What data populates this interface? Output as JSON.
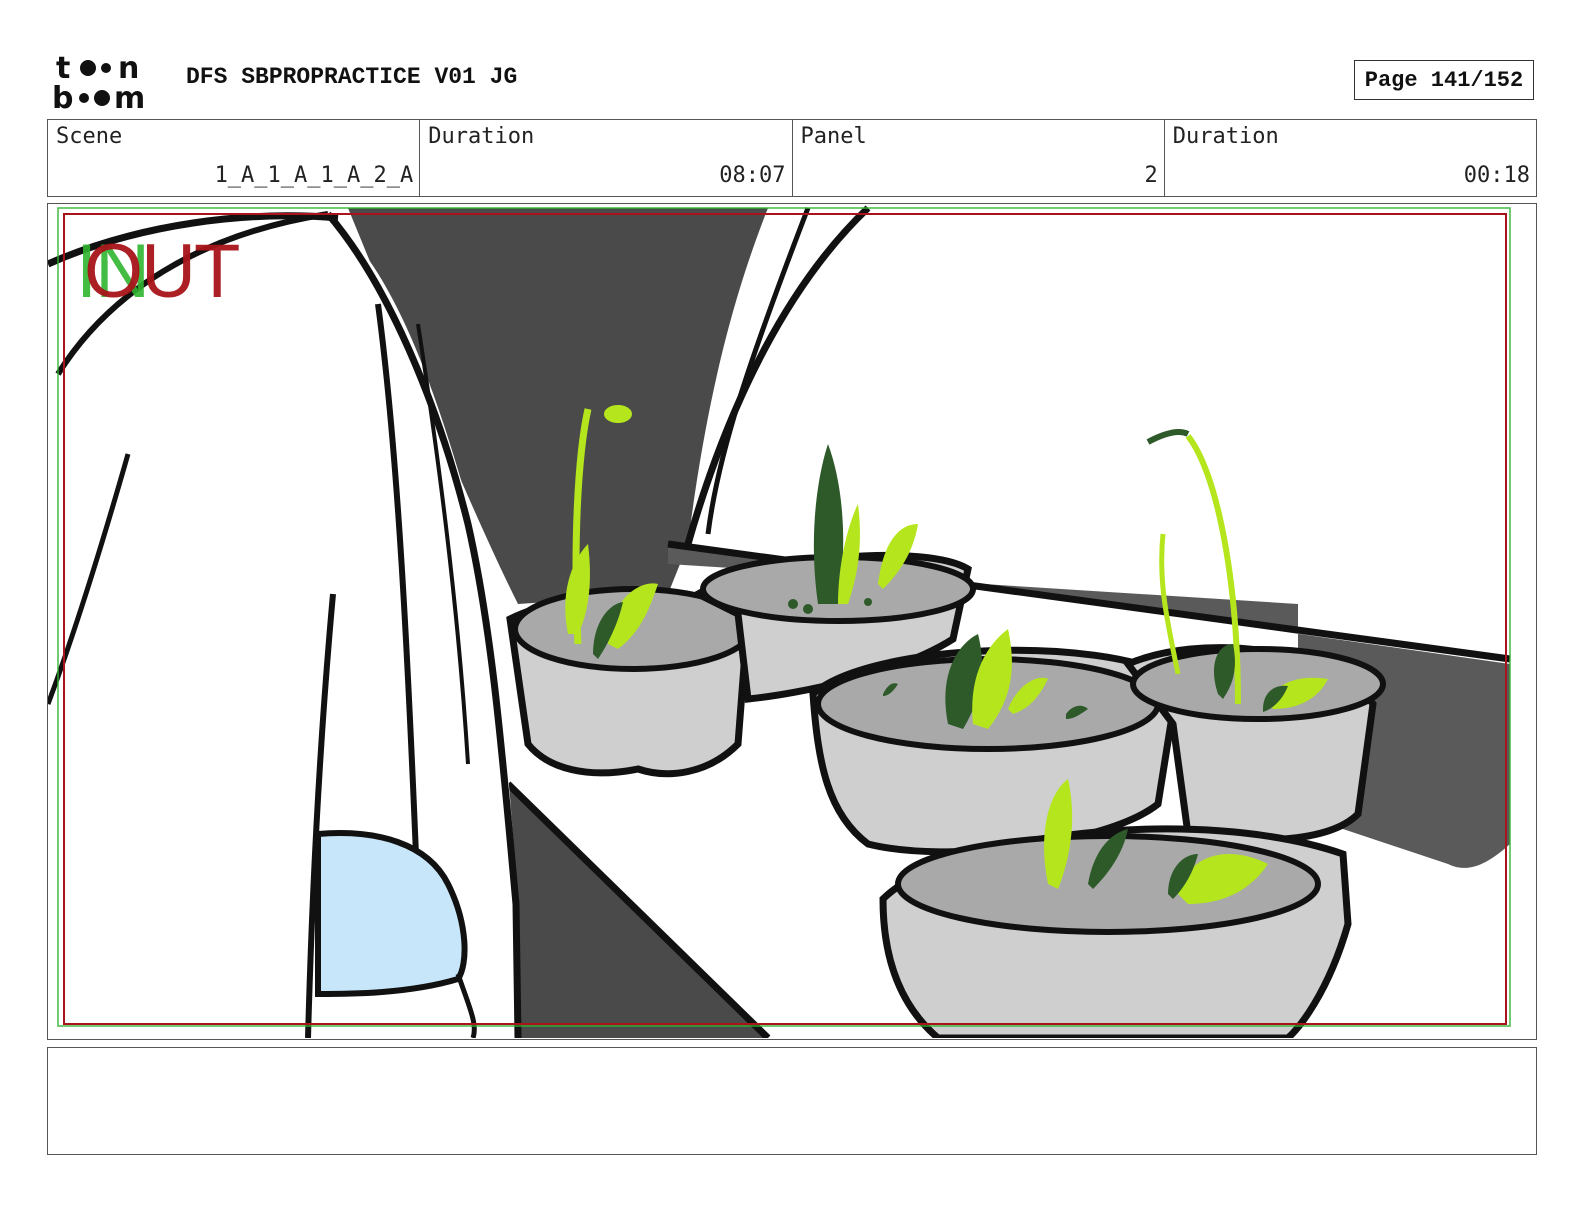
{
  "header": {
    "logo_top": "t",
    "logo_top2": "n",
    "logo_bottom": "b",
    "logo_bottom2": "m",
    "title": "DFS SBPROPRACTICE V01 JG",
    "page": "Page 141/152"
  },
  "info": {
    "scene_label": "Scene",
    "scene_value": "1_A_1_A_1_A_2_A",
    "duration_label": "Duration",
    "duration_value": "08:07",
    "panel_label": "Panel",
    "panel_value": "2",
    "panel_duration_label": "Duration",
    "panel_duration_value": "00:18"
  },
  "panel": {
    "in_label": "IN",
    "out_label": "OUT",
    "colors": {
      "in_frame": "#2fb52f",
      "out_frame": "#a8141a",
      "shadow": "#4a4a4a",
      "pot": "#cfcfcf",
      "soil": "#a9a9a9",
      "leaf_light": "#b5e61d",
      "leaf_dark": "#2e5a2a",
      "glove": "#c8e6fa"
    }
  },
  "notes": {
    "text": ""
  }
}
